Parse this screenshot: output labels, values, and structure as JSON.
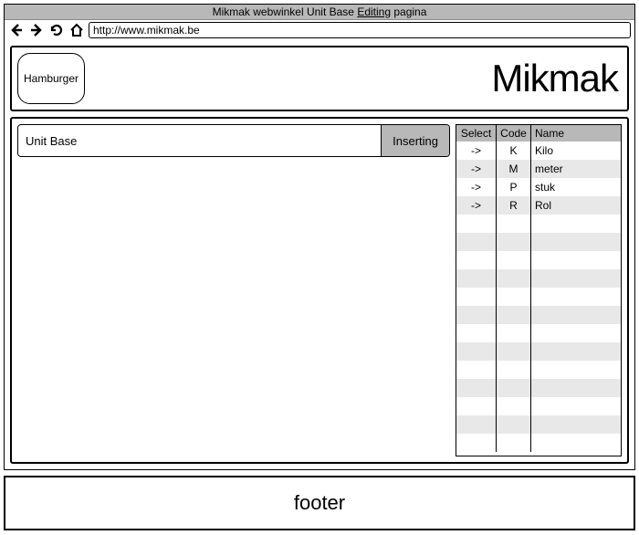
{
  "window": {
    "title_prefix": "Mikmak webwinkel Unit Base ",
    "title_link": "Editing",
    "title_suffix": " pagina",
    "url": "http://www.mikmak.be"
  },
  "header": {
    "hamburger_label": "Hamburger",
    "brand": "Mikmak"
  },
  "entity": {
    "name": "Unit Base",
    "status": "Inserting"
  },
  "table": {
    "headers": {
      "select": "Select",
      "code": "Code",
      "name": "Name"
    },
    "rows": [
      {
        "select": "->",
        "code": "K",
        "name": "Kilo"
      },
      {
        "select": "->",
        "code": "M",
        "name": "meter"
      },
      {
        "select": "->",
        "code": "P",
        "name": "stuk"
      },
      {
        "select": "->",
        "code": "R",
        "name": "Rol"
      }
    ],
    "blank_rows": 13
  },
  "footer": {
    "label": "footer"
  }
}
